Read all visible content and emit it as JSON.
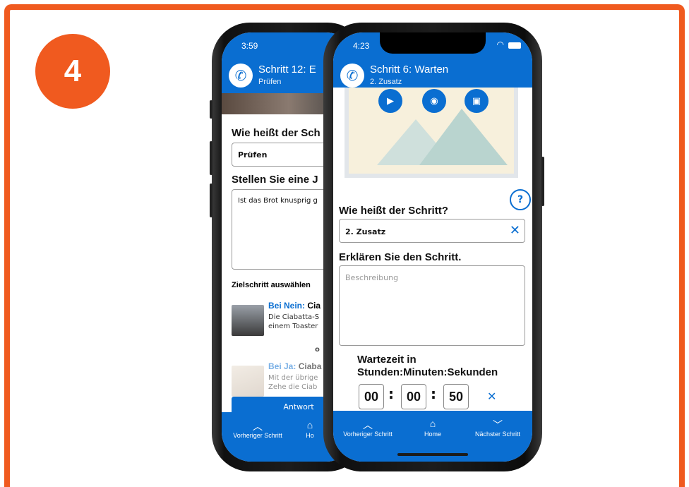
{
  "step_badge": "4",
  "back_phone": {
    "status_time": "3:59",
    "title": "Schritt 12: E",
    "subtitle": "Prüfen",
    "name_label": "Wie heißt der Sch",
    "name_value": "Prüfen",
    "question_label": "Stellen Sie eine J",
    "question_value": "Ist das Brot knusprig g",
    "target_label": "Zielschritt auswählen",
    "option_no_prefix": "Bei Nein:",
    "option_no_title": "Cia",
    "option_no_line1": "Die Ciabatta-S",
    "option_no_line2": "einem Toaster",
    "or_label": "o",
    "option_yes_prefix": "Bei Ja:",
    "option_yes_title": "Ciaba",
    "option_yes_line1": "Mit der übrige",
    "option_yes_line2": "Zehe die Ciab",
    "answer_button": "Antwort",
    "nav_prev": "Vorheriger Schritt",
    "nav_home": "Ho"
  },
  "front_phone": {
    "status_time": "4:23",
    "title": "Schritt 6: Warten",
    "subtitle": "2. Zusatz",
    "name_label": "Wie heißt der Schritt?",
    "name_value": "2. Zusatz",
    "explain_label": "Erklären Sie den Schritt.",
    "description_placeholder": "Beschreibung",
    "wait_label_line1": "Wartezeit in",
    "wait_label_line2": "Stunden:Minuten:Sekunden",
    "hours": "00",
    "minutes": "00",
    "seconds": "50",
    "nav_prev": "Vorheriger Schritt",
    "nav_home": "Home",
    "nav_next": "Nächster Schritt"
  },
  "colors": {
    "accent": "#0a6ed1",
    "brand_orange": "#f05a1f"
  },
  "icons": [
    "phone-call-icon",
    "video-icon",
    "camera-icon",
    "gallery-icon",
    "help-icon",
    "clear-icon",
    "chevron-up-icon",
    "home-icon",
    "chevron-down-icon",
    "wifi-icon",
    "battery-icon"
  ]
}
